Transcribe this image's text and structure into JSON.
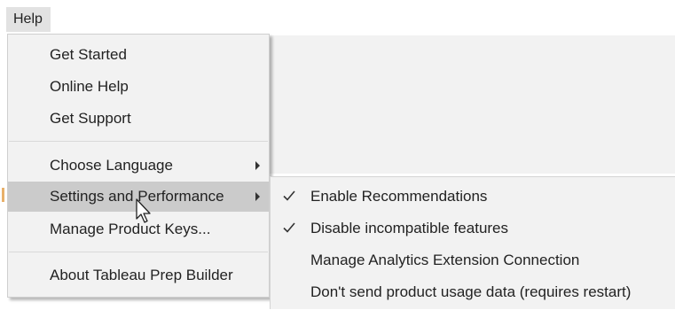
{
  "menubar": {
    "help_label": "Help"
  },
  "help_menu": {
    "items": [
      {
        "label": "Get Started"
      },
      {
        "label": "Online Help"
      },
      {
        "label": "Get Support"
      },
      {
        "label": "Choose Language",
        "has_submenu": true
      },
      {
        "label": "Settings and Performance",
        "has_submenu": true,
        "highlighted": true
      },
      {
        "label": "Manage Product Keys..."
      },
      {
        "label": "About Tableau Prep Builder"
      }
    ]
  },
  "settings_submenu": {
    "items": [
      {
        "label": "Enable Recommendations",
        "checked": true
      },
      {
        "label": "Disable incompatible features",
        "checked": true
      },
      {
        "label": "Manage Analytics Extension Connection",
        "checked": false
      },
      {
        "label": "Don't send product usage data (requires restart)",
        "checked": false
      }
    ]
  },
  "icons": {
    "check": "checkmark-icon",
    "arrow": "chevron-right-icon",
    "cursor": "mouse-pointer-icon"
  },
  "colors": {
    "menu_bg": "#f2f2f2",
    "highlight_bg": "#cbcbcb",
    "menubar_active": "#e2e2e2",
    "text": "#222222"
  }
}
